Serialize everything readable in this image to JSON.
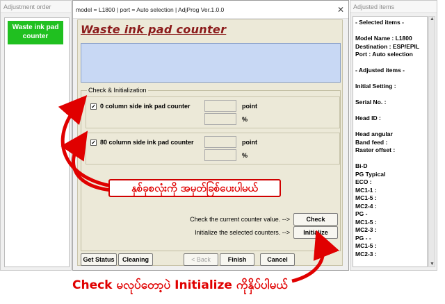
{
  "left_panel": {
    "title": "Adjustment order",
    "item": "Waste ink pad counter"
  },
  "window": {
    "title": "model = L1800 | port = Auto selection | AdjProg Ver.1.0.0",
    "close_glyph": "✕"
  },
  "content": {
    "heading": "Waste ink pad counter",
    "group_label": "Check & Initialization",
    "rows": [
      {
        "label": "0 column side ink pad counter",
        "checked": true,
        "unit1": "point",
        "unit2": "%"
      },
      {
        "label": "80 column side ink pad counter",
        "checked": true,
        "unit1": "point",
        "unit2": "%"
      }
    ],
    "check_hint": "Check the current counter value. -->",
    "init_hint": "Initialize the selected counters. -->",
    "check_button": "Check",
    "init_button": "Initialize"
  },
  "footer": {
    "get_status": "Get Status",
    "cleaning": "Cleaning",
    "back": "< Back",
    "finish": "Finish",
    "cancel": "Cancel"
  },
  "right_panel": {
    "title": "Adjusted items",
    "lines": [
      "- Selected items -",
      "",
      "Model Name : L1800",
      "Destination : ESP/EPIL",
      "Port : Auto selection",
      "",
      "- Adjusted items -",
      "",
      "Initial Setting :",
      "",
      "Serial No. :",
      "",
      "Head ID :",
      "",
      "Head angular",
      " Band feed :",
      " Raster offset :",
      "",
      "Bi-D",
      "PG Typical",
      " ECO  :",
      " MC1-1 :",
      " MC1-5 :",
      " MC2-4 :",
      "PG -",
      " MC1-5 :",
      " MC2-3 :",
      "PG - -",
      " MC1-5 :",
      " MC2-3 :"
    ]
  },
  "annotations": {
    "middle_note": "နှစ်ခုစလုံးကို အမှတ်ခြစ်ပေးပါမယ်",
    "bottom_note": "Check မလုပ်တော့ပဲ Initialize ကိုနှိပ်ပါမယ်"
  },
  "colors": {
    "accent_green": "#20c020",
    "heading_red": "#8b1a1a",
    "annotation_red": "#e00000",
    "info_blue": "#c8d8f4"
  }
}
